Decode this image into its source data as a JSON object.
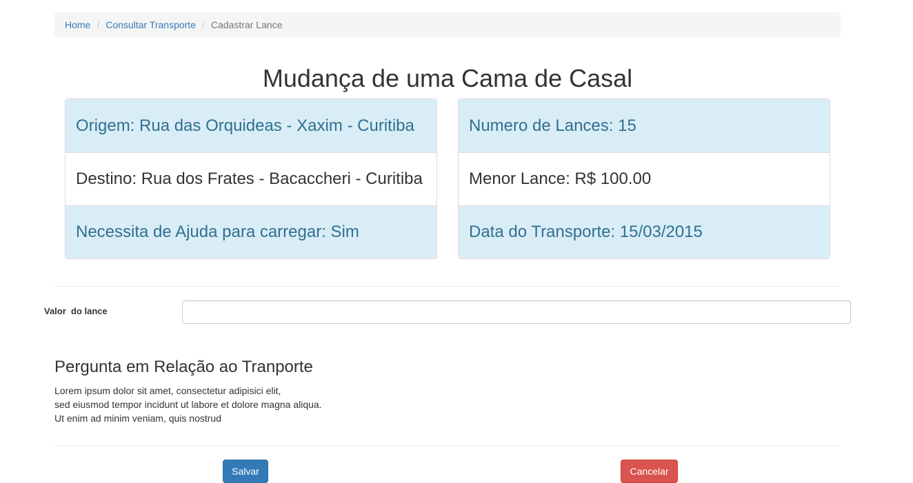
{
  "breadcrumb": {
    "home": "Home",
    "consult": "Consultar Transporte",
    "current": "Cadastrar Lance",
    "separator": "/"
  },
  "title": "Mudança de uma Cama de Casal",
  "details_left": [
    "Origem: Rua das Orquideas - Xaxim - Curitiba",
    "Destino: Rua dos Frates - Bacaccheri - Curitiba",
    "Necessita de Ajuda para carregar: Sim"
  ],
  "details_right": [
    "Numero de Lances: 15",
    "Menor Lance: R$ 100.00",
    "Data do Transporte: 15/03/2015"
  ],
  "bid": {
    "label": "Valor  do lance",
    "value": ""
  },
  "question": {
    "title": "Pergunta em Relação ao Tranporte",
    "lines": [
      "Lorem ipsum dolor sit amet, consectetur adipisici elit,",
      "sed eiusmod tempor incidunt ut labore et dolore magna aliqua.",
      "Ut enim ad minim veniam, quis nostrud"
    ]
  },
  "buttons": {
    "save": "Salvar",
    "cancel": "Cancelar"
  },
  "colors": {
    "primary": "#337ab7",
    "danger": "#d9534f",
    "info_bg": "#d9edf7",
    "info_text": "#31708f"
  }
}
